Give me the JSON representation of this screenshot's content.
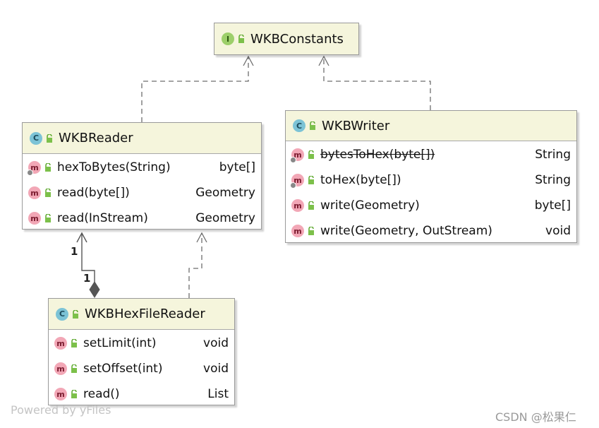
{
  "diagram": {
    "interface": {
      "badge": "I",
      "title": "WKBConstants"
    },
    "reader": {
      "badge": "C",
      "title": "WKBReader",
      "methods": [
        {
          "name": "hexToBytes(String)",
          "type": "byte[]",
          "static": true,
          "deprecated": false
        },
        {
          "name": "read(byte[])",
          "type": "Geometry",
          "static": false,
          "deprecated": false
        },
        {
          "name": "read(InStream)",
          "type": "Geometry",
          "static": false,
          "deprecated": false
        }
      ]
    },
    "writer": {
      "badge": "C",
      "title": "WKBWriter",
      "methods": [
        {
          "name": "bytesToHex(byte[])",
          "type": "String",
          "static": true,
          "deprecated": true
        },
        {
          "name": "toHex(byte[])",
          "type": "String",
          "static": true,
          "deprecated": false
        },
        {
          "name": "write(Geometry)",
          "type": "byte[]",
          "static": false,
          "deprecated": false
        },
        {
          "name": "write(Geometry, OutStream)",
          "type": "void",
          "static": false,
          "deprecated": false
        }
      ]
    },
    "hexreader": {
      "badge": "C",
      "title": "WKBHexFileReader",
      "methods": [
        {
          "name": "setLimit(int)",
          "type": "void",
          "static": false,
          "deprecated": false
        },
        {
          "name": "setOffset(int)",
          "type": "void",
          "static": false,
          "deprecated": false
        },
        {
          "name": "read()",
          "type": "List",
          "static": false,
          "deprecated": false
        }
      ]
    },
    "composition": {
      "mult_reader_end": "1",
      "mult_owner_end": "1"
    },
    "method_badge": "m"
  },
  "colors": {
    "header_bg": "#f5f5dc",
    "class_badge": "#7cc3d6",
    "interface_badge": "#9dcf6a",
    "method_badge": "#f2a7b6",
    "edge": "#6e6e6e"
  },
  "watermarks": {
    "left": "Powered by yFiles",
    "right": "CSDN @松果仁"
  }
}
